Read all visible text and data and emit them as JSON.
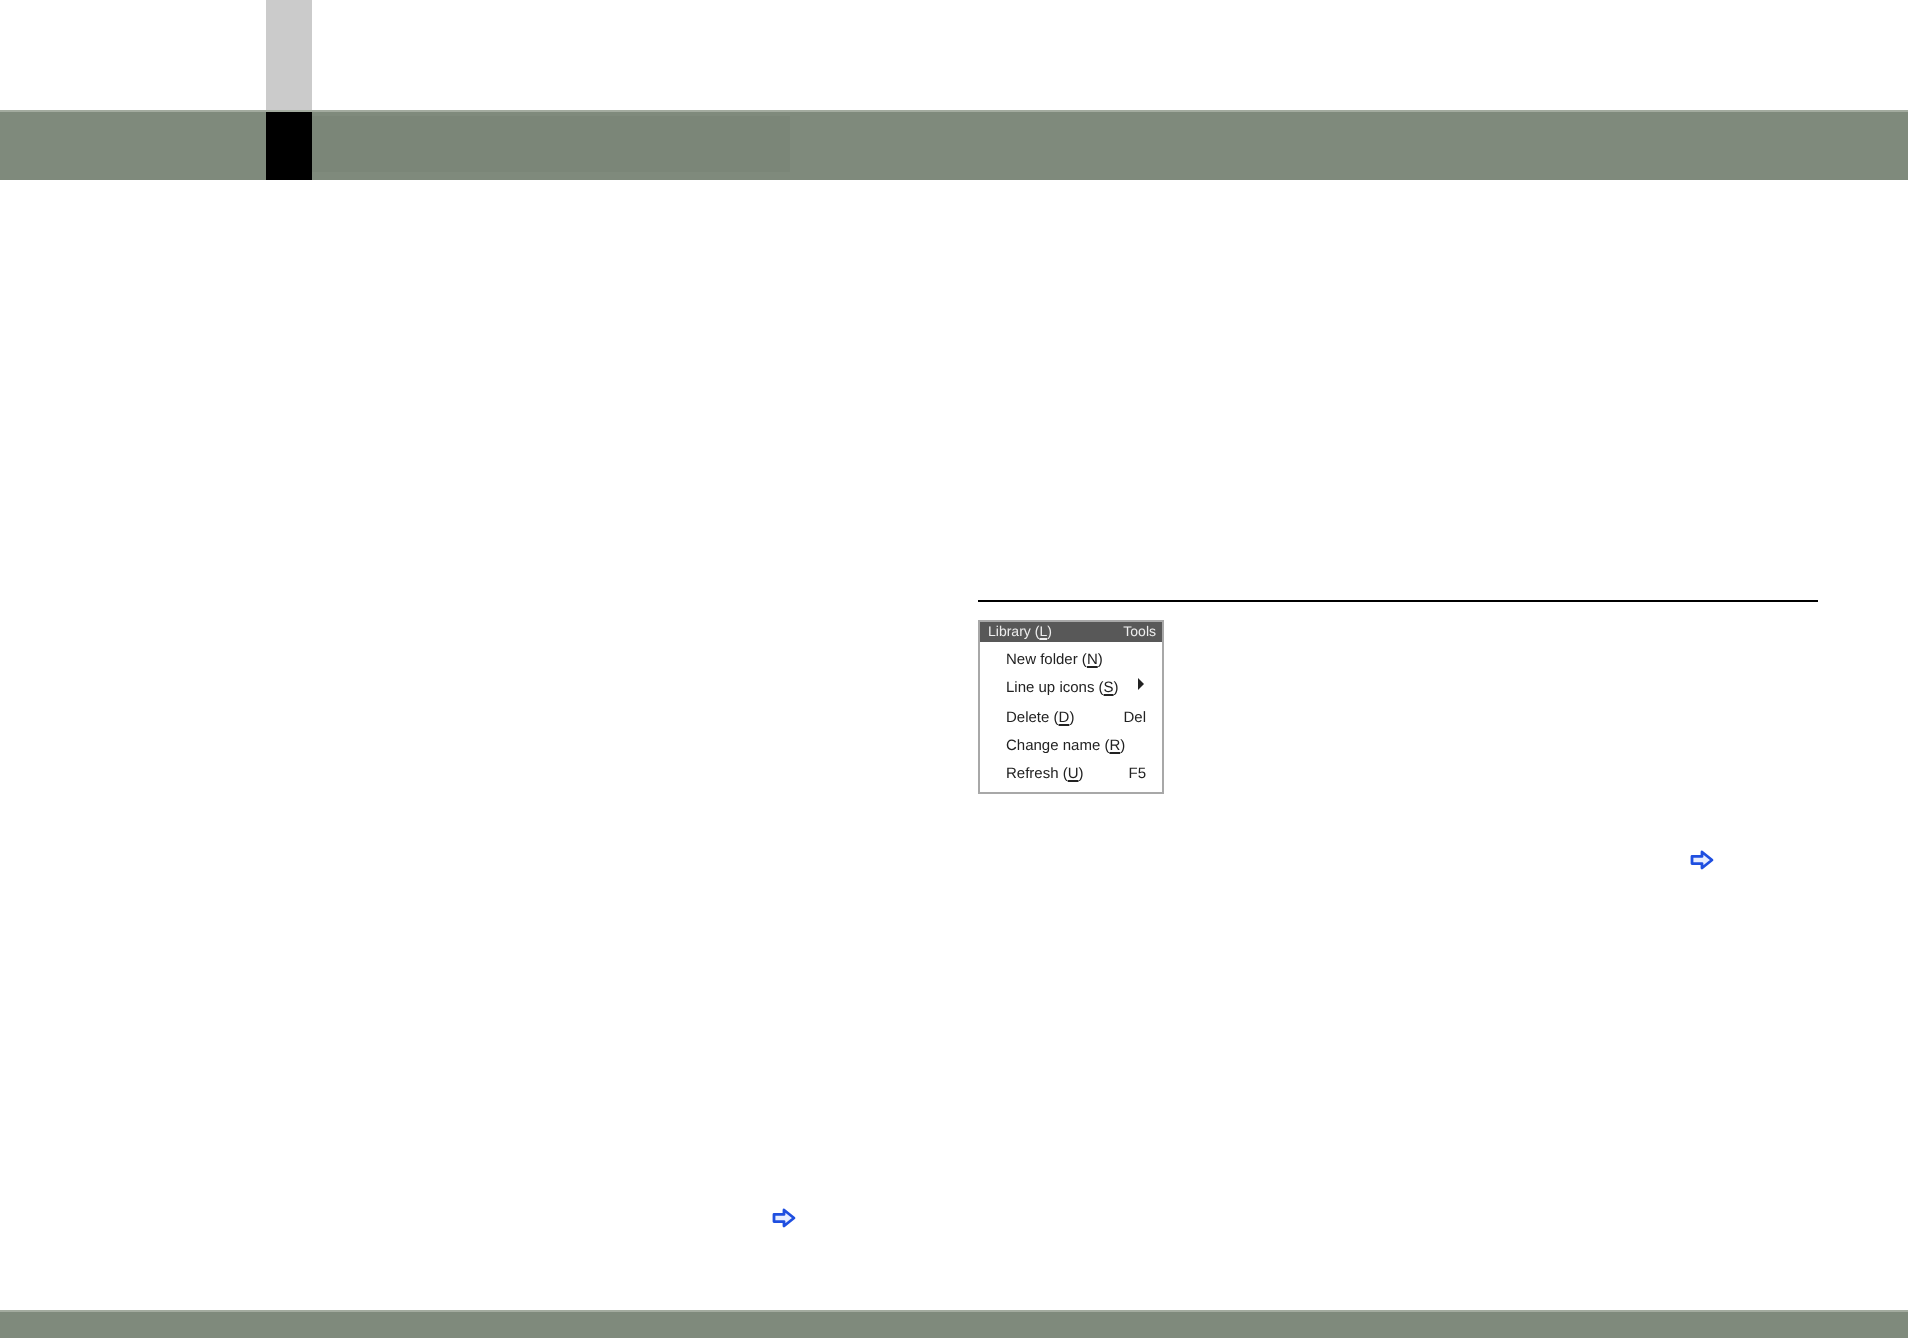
{
  "menu_screenshot": {
    "menubar": [
      {
        "text": "Library (",
        "mnemonic": "L",
        "after": ")"
      },
      {
        "text": "Tools"
      }
    ],
    "items": [
      {
        "text": "New folder (",
        "mnemonic": "N",
        "after": ")",
        "submenu": false
      },
      {
        "text": "Line up icons (",
        "mnemonic": "S",
        "after": ")",
        "submenu": true
      },
      {
        "text": "Delete (",
        "mnemonic": "D",
        "after": ")",
        "shortcut": "Del",
        "submenu": false
      },
      {
        "text": "Change name (",
        "mnemonic": "R",
        "after": ")",
        "submenu": false
      },
      {
        "text": "Refresh (",
        "mnemonic": "U",
        "after": ")",
        "shortcut": "F5",
        "submenu": false
      }
    ]
  }
}
